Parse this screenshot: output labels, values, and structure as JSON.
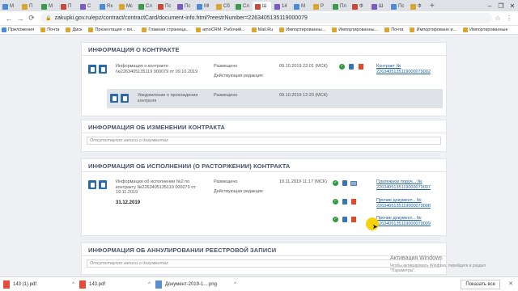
{
  "browser": {
    "tabs": [
      "М",
      "П",
      "М",
      "П",
      "С",
      "Rх",
      "Мc",
      "Сл",
      "Пс",
      "Пс",
      "Ml",
      "Сб",
      "Сл",
      "Ш",
      "14",
      "М",
      "Р",
      "Пл",
      "Ф",
      "Ш",
      "Пс",
      "Ф"
    ],
    "url": "zakupki.gov.ru/epz/contract/contractCard/document-info.html?reestrNumber=2263405135119000079",
    "bookmarks": [
      "Приложения",
      "Почта",
      "Диск",
      "Презентация « ви...",
      "Главная страница...",
      "amoCRM: Рабочий...",
      "Mail.Ru",
      "Импортированны...",
      "Импортированны...",
      "Почта",
      "Импортировано и...",
      "Импортированные"
    ]
  },
  "contract_info": {
    "title": "ИНФОРМАЦИЯ О КОНТРАКТЕ",
    "doc_name": "Информация о контракте №2263405135119 000079 от 09.10.2019",
    "placed_label": "Размещено",
    "edition_label": "Действующая редакция",
    "placed_date": "09.10.2019 22:01 (МСК)",
    "link": "Контракт № 2263405135119000079002",
    "sub_name": "Уведомление о прохождении контроля",
    "sub_placed_label": "Размещено",
    "sub_date": "09.10.2019 12:20 (МСК)"
  },
  "contract_change": {
    "title": "ИНФОРМАЦИЯ ОБ ИЗМЕНЕНИИ КОНТРАКТА",
    "empty": "Отсутствуют записи о документах"
  },
  "contract_execution": {
    "title": "ИНФОРМАЦИЯ ОБ ИСПОЛНЕНИИ (О РАСТОРЖЕНИИ) КОНТРАКТА",
    "doc_name": "Информация об исполнении №2 по контракту №2263405135119 000079 от 19.11.2019",
    "placed_label": "Размещено",
    "edition_label": "Действующая редакция",
    "placed_date": "19.11.2019 11:17 (МСК)",
    "date": "31.12.2019",
    "links": [
      "Платежное поруч... № 2263405135119000079007",
      "Прочие документ... № 2263405135119000079008",
      "Прочие документ... № 2263405135119000079009"
    ]
  },
  "contract_cancel": {
    "title": "ИНФОРМАЦИЯ ОБ АННУЛИРОВАНИИ РЕЕСТРОВОЙ ЗАПИСИ",
    "empty": "Отсутствуют записи о документах"
  },
  "watermark": {
    "title": "Активация Windows",
    "text": "Чтобы активировать Windows, перейдите в раздел \"Параметры\"."
  },
  "downloads": {
    "files": [
      "143 (1).pdf",
      "143.pdf",
      "Документ-2019-1....png"
    ],
    "show_all": "Показать все"
  }
}
